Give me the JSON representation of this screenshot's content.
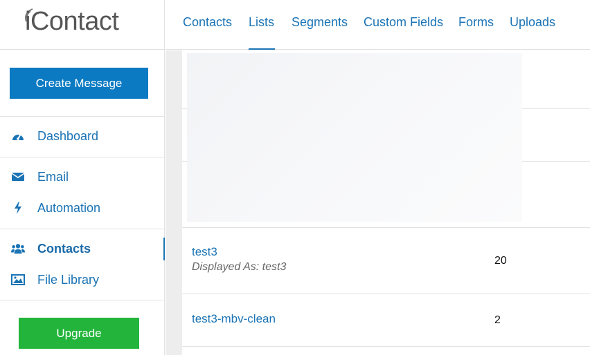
{
  "brand": {
    "logo_text": "iContact"
  },
  "sidebar": {
    "create_label": "Create Message",
    "items": [
      {
        "label": "Dashboard",
        "icon": "dashboard-icon"
      },
      {
        "label": "Email",
        "icon": "envelope-icon"
      },
      {
        "label": "Automation",
        "icon": "bolt-icon"
      },
      {
        "label": "Contacts",
        "icon": "users-icon",
        "active": true
      },
      {
        "label": "File Library",
        "icon": "image-icon"
      }
    ],
    "upgrade_label": "Upgrade"
  },
  "topnav": {
    "tabs": [
      {
        "label": "Contacts"
      },
      {
        "label": "Lists",
        "active": true
      },
      {
        "label": "Segments"
      },
      {
        "label": "Custom Fields"
      },
      {
        "label": "Forms"
      },
      {
        "label": "Uploads"
      }
    ]
  },
  "lists": [
    {
      "name": "test3",
      "displayed_as": "Displayed As: test3",
      "count": "20"
    },
    {
      "name": "test3-mbv-clean",
      "count": "2"
    }
  ],
  "colors": {
    "primary": "#0b7ac2",
    "link": "#1a73b5",
    "upgrade": "#23b53b"
  }
}
